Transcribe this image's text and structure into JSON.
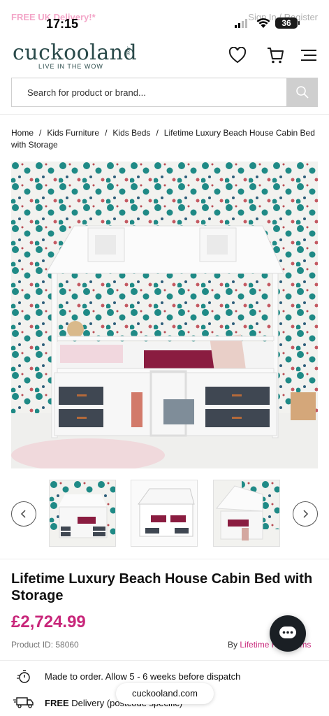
{
  "status": {
    "time": "17:15",
    "battery": "36"
  },
  "topbar": {
    "promo": "FREE UK Delivery!*",
    "account": "Sign In / Register"
  },
  "header": {
    "logo": "cuckooland",
    "logo_suffix": ".com",
    "tagline": "LIVE IN THE WOW"
  },
  "search": {
    "placeholder": "Search for product or brand..."
  },
  "breadcrumb": [
    "Home",
    "Kids Furniture",
    "Kids Beds",
    "Lifetime Luxury Beach House Cabin Bed with Storage"
  ],
  "product": {
    "title": "Lifetime Luxury Beach House Cabin Bed with Storage",
    "price": "£2,724.99",
    "product_id": "Product ID: 58060",
    "brand_prefix": "By",
    "brand_name": "Lifetime Kidsrooms"
  },
  "info": {
    "made_to_order": "Made to order. Allow 5 - 6 weeks before dispatch",
    "delivery_bold": "FREE",
    "delivery_rest": " Delivery (postcode specific)"
  },
  "browser": {
    "url": "cuckooland.com"
  },
  "colors": {
    "accent": "#c8267a",
    "logo": "#2a4a4a",
    "promo": "#f3a6c8"
  }
}
